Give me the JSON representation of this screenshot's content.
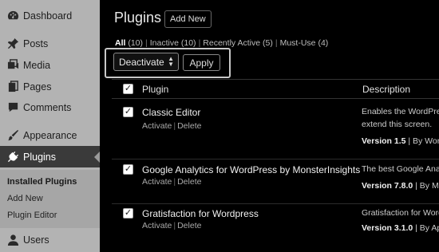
{
  "sidebar": {
    "items": [
      {
        "label": "Dashboard",
        "icon": "dashboard-icon"
      },
      {
        "label": "Posts",
        "icon": "pin-icon"
      },
      {
        "label": "Media",
        "icon": "media-icon"
      },
      {
        "label": "Pages",
        "icon": "pages-icon"
      },
      {
        "label": "Comments",
        "icon": "comment-icon"
      },
      {
        "label": "Appearance",
        "icon": "brush-icon"
      },
      {
        "label": "Plugins",
        "icon": "plug-icon"
      },
      {
        "label": "Users",
        "icon": "user-icon"
      }
    ],
    "submenu": [
      "Installed Plugins",
      "Add New",
      "Plugin Editor"
    ]
  },
  "header": {
    "title": "Plugins",
    "add_new": "Add New"
  },
  "filters": {
    "all": "All",
    "all_count": "(10)",
    "inactive": "Inactive",
    "inactive_count": "(10)",
    "recent": "Recently Active",
    "recent_count": "(5)",
    "mustuse": "Must-Use",
    "mustuse_count": "(4)"
  },
  "bulk": {
    "selected": "Deactivate",
    "apply": "Apply"
  },
  "table": {
    "col_plugin": "Plugin",
    "col_desc": "Description",
    "rows": [
      {
        "name": "Classic Editor",
        "activate": "Activate",
        "delete": "Delete",
        "desc1": "Enables the WordPres",
        "desc2": "extend this screen.",
        "version": "Version 1.5",
        "by": " | By Wor"
      },
      {
        "name": "Google Analytics for WordPress by MonsterInsights",
        "activate": "Activate",
        "delete": "Delete",
        "desc1": "The best Google Ana",
        "desc2": "",
        "version": "Version 7.8.0",
        "by": " | By Mon"
      },
      {
        "name": "Gratisfaction for Wordpress",
        "activate": "Activate",
        "delete": "Delete",
        "desc1": "Gratisfaction for Word",
        "desc2": "",
        "version": "Version 3.1.0",
        "by": " | By Ap"
      }
    ]
  }
}
